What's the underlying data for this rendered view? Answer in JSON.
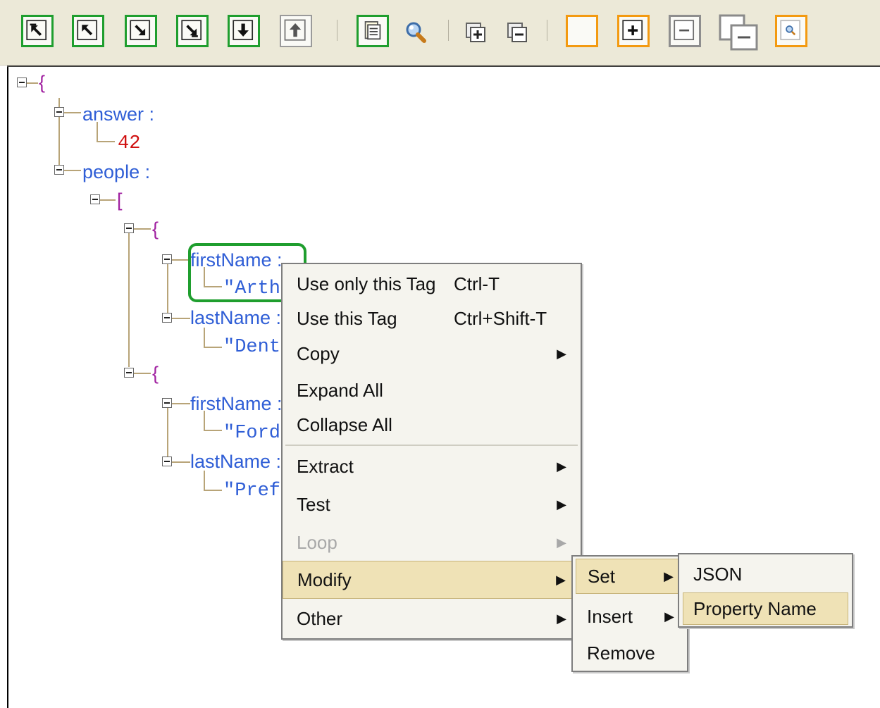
{
  "toolbar": {
    "buttons": [
      {
        "name": "go-to-root-button",
        "icon": "arrow-up-left-bar-icon"
      },
      {
        "name": "go-to-parent-button",
        "icon": "arrow-up-left-icon"
      },
      {
        "name": "go-to-child-button",
        "icon": "arrow-down-right-icon"
      },
      {
        "name": "go-to-last-child-button",
        "icon": "arrow-down-right-bar-icon"
      },
      {
        "name": "move-down-button",
        "icon": "arrow-down-icon"
      },
      {
        "name": "move-up-button",
        "icon": "arrow-up-icon"
      },
      {
        "name": "document-button",
        "icon": "document-icon"
      },
      {
        "name": "find-button",
        "icon": "magnifier-icon"
      },
      {
        "name": "expand-button",
        "icon": "expand-box-icon"
      },
      {
        "name": "collapse-button",
        "icon": "collapse-box-icon"
      },
      {
        "name": "blank-button",
        "icon": "blank-icon"
      },
      {
        "name": "add-button",
        "icon": "plus-icon"
      },
      {
        "name": "remove-button",
        "icon": "minus-icon"
      },
      {
        "name": "cascade-collapse-button",
        "icon": "cascade-minus-icon"
      },
      {
        "name": "zoom-button",
        "icon": "zoom-icon"
      }
    ],
    "highlight_colors": {
      "green": "#1f9e2e",
      "orange": "#f39a11",
      "gray": "#8e8e8e"
    }
  },
  "tree": {
    "root_open": "{",
    "answer_key": "answer :",
    "answer_value": "42",
    "people_key": "people :",
    "array_open": "[",
    "obj1_open": "{",
    "first_name_key": "firstName :",
    "first_name_value": "\"Arthur\"",
    "last_name_key": "lastName :",
    "last_name_value": "\"Dent\"",
    "obj2_open": "{",
    "first_name_key_2": "firstName :",
    "first_name_value_2": "\"Ford\"",
    "last_name_key_2": "lastName :",
    "last_name_value_2": "\"Prefect\""
  },
  "context_menu": {
    "use_only_tag": "Use only this Tag",
    "use_only_tag_shortcut": "Ctrl-T",
    "use_tag": "Use this Tag",
    "use_tag_shortcut": "Ctrl+Shift-T",
    "copy": "Copy",
    "expand_all": "Expand All",
    "collapse_all": "Collapse All",
    "extract": "Extract",
    "test": "Test",
    "loop": "Loop",
    "modify": "Modify",
    "other": "Other",
    "submenu_arrow": "▶"
  },
  "modify_submenu": {
    "set": "Set",
    "insert": "Insert",
    "remove": "Remove"
  },
  "set_submenu": {
    "json": "JSON",
    "property_name": "Property Name"
  }
}
